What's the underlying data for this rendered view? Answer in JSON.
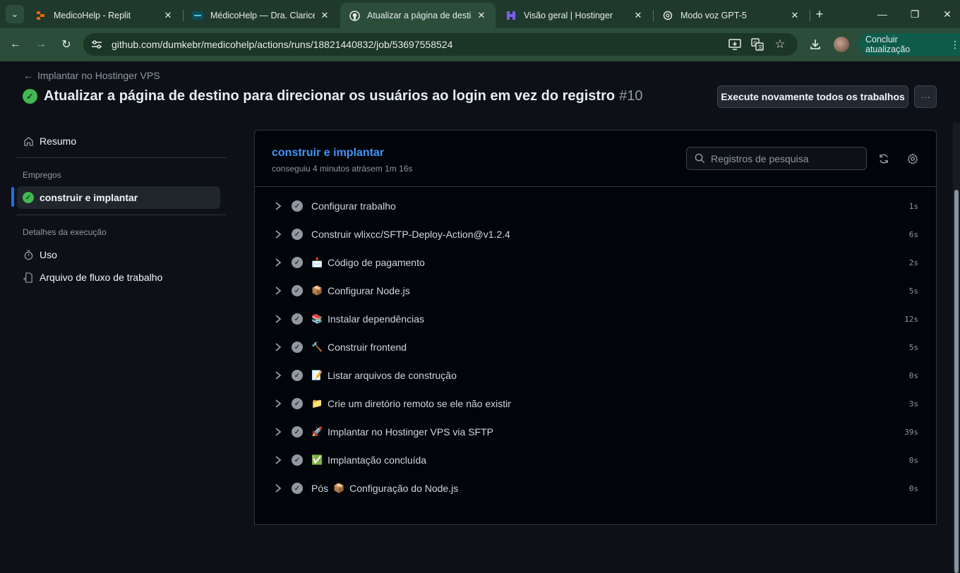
{
  "browser": {
    "tabs": [
      {
        "title": "MedicoHelp - Replit",
        "icon": "replit-icon",
        "active": false
      },
      {
        "title": "MédicoHelp — Dra. Clarice",
        "icon": "medicohelp-icon",
        "active": false
      },
      {
        "title": "Atualizar a página de destino",
        "icon": "github-icon",
        "active": true
      },
      {
        "title": "Visão geral | Hostinger",
        "icon": "hostinger-icon",
        "active": false
      },
      {
        "title": "Modo voz GPT-5",
        "icon": "openai-icon",
        "active": false
      }
    ],
    "url": "github.com/dumkebr/medicohelp/actions/runs/18821440832/job/53697558524",
    "update_label": "Concluir atualização"
  },
  "header": {
    "back_link": "Implantar no Hostinger VPS",
    "title": "Atualizar a página de destino para direcionar os usuários ao login em vez do registro",
    "run_number": "#10",
    "rerun_label": "Execute novamente todos os trabalhos"
  },
  "sidebar": {
    "summary_label": "Resumo",
    "jobs_heading": "Empregos",
    "job_label": "construir e implantar",
    "details_heading": "Detalhes da execução",
    "usage_label": "Uso",
    "workflow_file_label": "Arquivo de fluxo de trabalho"
  },
  "job": {
    "name": "construir e implantar",
    "meta": "conseguiu 4 minutos atrásem 1m 16s",
    "search_placeholder": "Registros de pesquisa",
    "steps": [
      {
        "prefix": "",
        "emoji": "",
        "label": "Configurar trabalho",
        "duration": "1s"
      },
      {
        "prefix": "",
        "emoji": "",
        "label": "Construir wlixcc/SFTP-Deploy-Action@v1.2.4",
        "duration": "6s"
      },
      {
        "prefix": "",
        "emoji": "📩",
        "label": "Código de pagamento",
        "duration": "2s"
      },
      {
        "prefix": "",
        "emoji": "📦",
        "label": "Configurar Node.js",
        "duration": "5s"
      },
      {
        "prefix": "",
        "emoji": "📚",
        "label": "Instalar dependências",
        "duration": "12s"
      },
      {
        "prefix": "",
        "emoji": "🔨",
        "label": "Construir frontend",
        "duration": "5s"
      },
      {
        "prefix": "",
        "emoji": "📝",
        "label": "Listar arquivos de construção",
        "duration": "0s"
      },
      {
        "prefix": "",
        "emoji": "📁",
        "label": "Crie um diretório remoto se ele não existir",
        "duration": "3s"
      },
      {
        "prefix": "",
        "emoji": "🚀",
        "label": "Implantar no Hostinger VPS via SFTP",
        "duration": "39s"
      },
      {
        "prefix": "",
        "emoji": "✅",
        "label": "Implantação concluída",
        "duration": "0s"
      },
      {
        "prefix": "Pós",
        "emoji": "📦",
        "label": "Configuração do Node.js",
        "duration": "0s"
      }
    ]
  },
  "colors": {
    "success": "#3fb950",
    "link": "#4493f8",
    "accent_bar": "#1f6feb",
    "browser_frame": "#2b4d3a"
  }
}
